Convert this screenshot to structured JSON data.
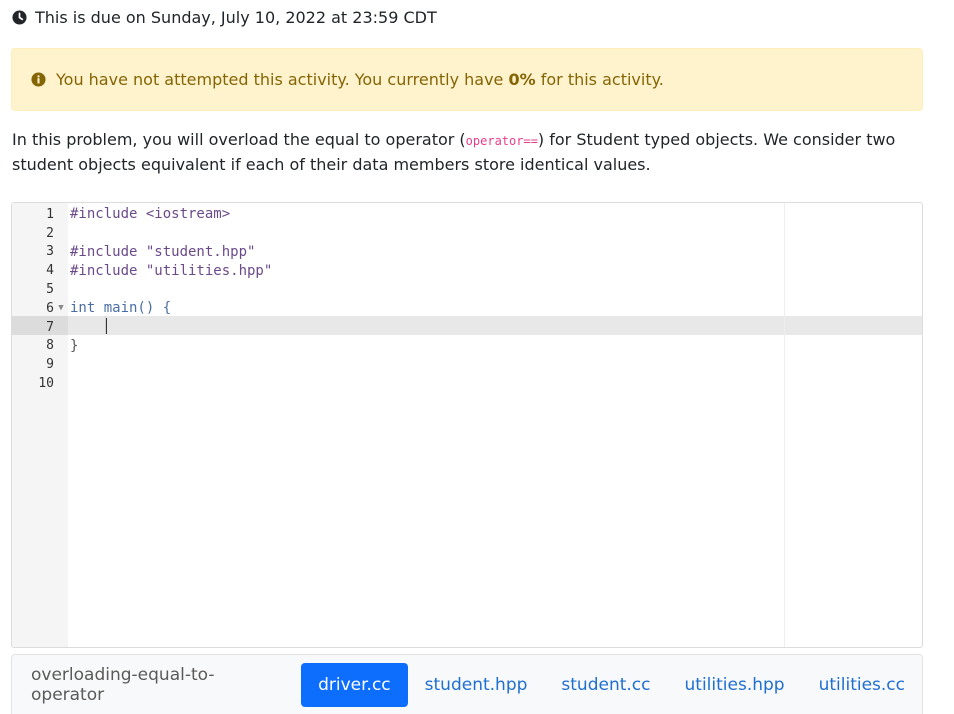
{
  "due": {
    "icon": "clock-icon",
    "text": "This is due on Sunday, July 10, 2022 at 23:59 CDT"
  },
  "alert": {
    "icon": "info-circle-icon",
    "text_before": "You have not attempted this activity. You currently have ",
    "score": "0%",
    "text_after": " for this activity.",
    "background_color": "#fff3cd",
    "text_color": "#856404"
  },
  "description": {
    "part1": "In this problem, you will overload the equal to operator (",
    "code": "operator==",
    "part2": ") for Student typed objects. We consider two student objects equivalent if each of their data members store identical values."
  },
  "editor": {
    "lines": [
      {
        "number": "1",
        "text": "#include <iostream>"
      },
      {
        "number": "2",
        "text": ""
      },
      {
        "number": "3",
        "text": "#include \"student.hpp\""
      },
      {
        "number": "4",
        "text": "#include \"utilities.hpp\""
      },
      {
        "number": "5",
        "text": ""
      },
      {
        "number": "6",
        "text": "int main() {"
      },
      {
        "number": "7",
        "text": ""
      },
      {
        "number": "8",
        "text": "}"
      },
      {
        "number": "9",
        "text": ""
      },
      {
        "number": "10",
        "text": ""
      }
    ],
    "active_line": "7"
  },
  "tabs": {
    "title": "overloading-equal-to-operator",
    "items": [
      {
        "label": "driver.cc",
        "active": true
      },
      {
        "label": "student.hpp",
        "active": false
      },
      {
        "label": "student.cc",
        "active": false
      },
      {
        "label": "utilities.hpp",
        "active": false
      },
      {
        "label": "utilities.cc",
        "active": false
      }
    ],
    "active_color": "#0d6efd",
    "link_color": "#1f6fd0"
  }
}
